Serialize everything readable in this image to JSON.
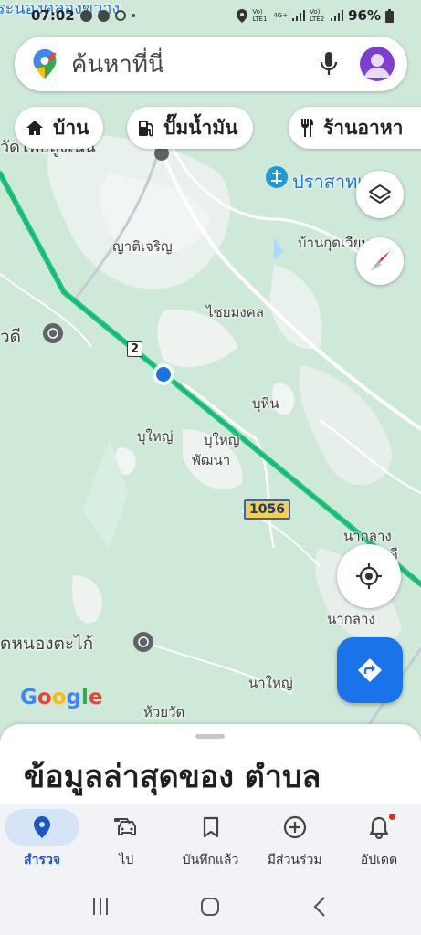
{
  "status_bar": {
    "time": "07:02",
    "sim1": "Vo) LTE1",
    "network": "4G+",
    "sim2": "Vo) LTE2",
    "battery": "96%"
  },
  "search": {
    "placeholder": "ค้นหาที่นี่"
  },
  "chips": [
    {
      "label": "บ้าน",
      "icon": "home-icon"
    },
    {
      "label": "ปั๊มน้ำมัน",
      "icon": "gas-station-icon"
    },
    {
      "label": "ร้านอาหา",
      "icon": "restaurant-icon"
    }
  ],
  "map": {
    "places": [
      {
        "name": "ระนองคลองขวาง",
        "id": "place-top"
      },
      {
        "name": "วัดโพธิ์สูงเนิน",
        "id": "place-wat-top"
      },
      {
        "name": "ปราสาทเมือง",
        "id": "place-prasat"
      },
      {
        "name": "บ้านกุดเวียน",
        "id": "place-kud"
      },
      {
        "name": "ญาติเจริญ",
        "id": "place-yat"
      },
      {
        "name": "ไชยมงคล",
        "id": "place-chai"
      },
      {
        "name": "วดี",
        "id": "place-wadi"
      },
      {
        "name": "บุหิน",
        "id": "place-buhin"
      },
      {
        "name": "บุใหญ่",
        "id": "place-buyai"
      },
      {
        "name": "บุใหญ่",
        "id": "place-buyai2"
      },
      {
        "name": "พัฒนา",
        "id": "place-pattana"
      },
      {
        "name": "นากลาง",
        "id": "place-naklang1"
      },
      {
        "name": "ดี",
        "id": "place-di"
      },
      {
        "name": "นากลาง",
        "id": "place-naklang2"
      },
      {
        "name": "ดหนองตะไก้",
        "id": "place-nongtakai"
      },
      {
        "name": "นาใหญ่",
        "id": "place-nayai"
      },
      {
        "name": "ห้วยวัด",
        "id": "place-huaywat"
      }
    ],
    "shields": {
      "route_2": "2",
      "route_1056": "1056"
    },
    "logo": "Google"
  },
  "sheet": {
    "title": "ข้อมูลล่าสุดของ ตำบล"
  },
  "nav": [
    {
      "label": "สำรวจ",
      "icon": "explore-pin-icon",
      "active": true
    },
    {
      "label": "ไป",
      "icon": "car-icon",
      "active": false
    },
    {
      "label": "บันทึกแล้ว",
      "icon": "bookmark-icon",
      "active": false
    },
    {
      "label": "มีส่วนร่วม",
      "icon": "add-circle-icon",
      "active": false
    },
    {
      "label": "อัปเดต",
      "icon": "bell-icon",
      "active": false
    }
  ],
  "colors": {
    "accent": "#1a73e8",
    "route": "#1ec77d",
    "map_bg": "#cfe9d9"
  }
}
